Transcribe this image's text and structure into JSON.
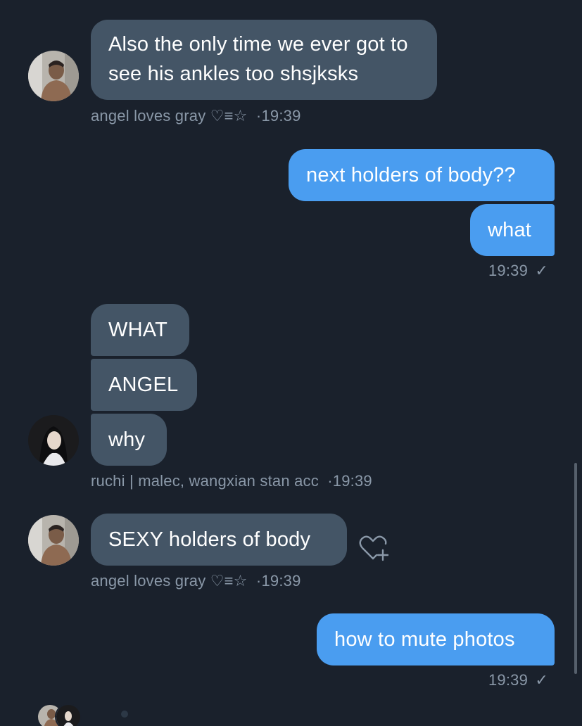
{
  "messages": {
    "m1": {
      "text": "Also the only time we ever got to see his ankles too shsjksks"
    },
    "m1_meta": {
      "sender": "angel loves gray ♡≡☆",
      "time": "·19:39"
    },
    "m2": {
      "text": "next holders of body??"
    },
    "m3": {
      "text": "what"
    },
    "m3_meta": {
      "time": "19:39",
      "check": "✓"
    },
    "m4": {
      "text": "WHAT"
    },
    "m5": {
      "text": "ANGEL"
    },
    "m6": {
      "text": "why"
    },
    "m6_meta": {
      "sender": "ruchi | malec, wangxian stan acc",
      "time": "·19:39"
    },
    "m7": {
      "text": "SEXY holders of body"
    },
    "m7_meta": {
      "sender": "angel loves gray ♡≡☆",
      "time": "·19:39"
    },
    "m8": {
      "text": "how to mute photos"
    },
    "m8_meta": {
      "time": "19:39",
      "check": "✓"
    }
  },
  "colors": {
    "background": "#1a212c",
    "incoming_bubble": "#445566",
    "outgoing_bubble": "#4a9df0",
    "meta_text": "#8a98a8"
  },
  "icons": {
    "reaction": "heart-plus-icon",
    "read_receipt": "check-icon"
  }
}
